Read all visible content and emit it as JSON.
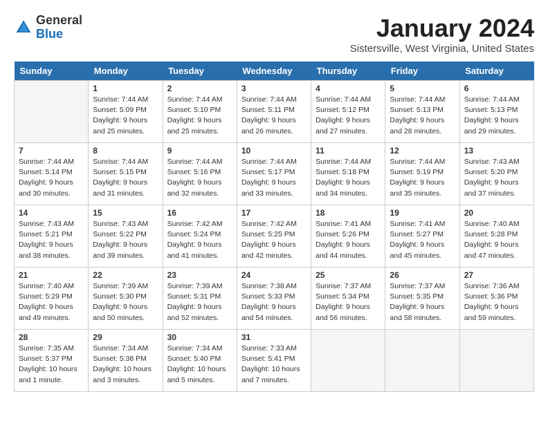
{
  "header": {
    "logo_general": "General",
    "logo_blue": "Blue",
    "month_title": "January 2024",
    "location": "Sistersville, West Virginia, United States"
  },
  "weekdays": [
    "Sunday",
    "Monday",
    "Tuesday",
    "Wednesday",
    "Thursday",
    "Friday",
    "Saturday"
  ],
  "weeks": [
    [
      {
        "day": "",
        "info": ""
      },
      {
        "day": "1",
        "info": "Sunrise: 7:44 AM\nSunset: 5:09 PM\nDaylight: 9 hours\nand 25 minutes."
      },
      {
        "day": "2",
        "info": "Sunrise: 7:44 AM\nSunset: 5:10 PM\nDaylight: 9 hours\nand 25 minutes."
      },
      {
        "day": "3",
        "info": "Sunrise: 7:44 AM\nSunset: 5:11 PM\nDaylight: 9 hours\nand 26 minutes."
      },
      {
        "day": "4",
        "info": "Sunrise: 7:44 AM\nSunset: 5:12 PM\nDaylight: 9 hours\nand 27 minutes."
      },
      {
        "day": "5",
        "info": "Sunrise: 7:44 AM\nSunset: 5:13 PM\nDaylight: 9 hours\nand 28 minutes."
      },
      {
        "day": "6",
        "info": "Sunrise: 7:44 AM\nSunset: 5:13 PM\nDaylight: 9 hours\nand 29 minutes."
      }
    ],
    [
      {
        "day": "7",
        "info": "Sunrise: 7:44 AM\nSunset: 5:14 PM\nDaylight: 9 hours\nand 30 minutes."
      },
      {
        "day": "8",
        "info": "Sunrise: 7:44 AM\nSunset: 5:15 PM\nDaylight: 9 hours\nand 31 minutes."
      },
      {
        "day": "9",
        "info": "Sunrise: 7:44 AM\nSunset: 5:16 PM\nDaylight: 9 hours\nand 32 minutes."
      },
      {
        "day": "10",
        "info": "Sunrise: 7:44 AM\nSunset: 5:17 PM\nDaylight: 9 hours\nand 33 minutes."
      },
      {
        "day": "11",
        "info": "Sunrise: 7:44 AM\nSunset: 5:18 PM\nDaylight: 9 hours\nand 34 minutes."
      },
      {
        "day": "12",
        "info": "Sunrise: 7:44 AM\nSunset: 5:19 PM\nDaylight: 9 hours\nand 35 minutes."
      },
      {
        "day": "13",
        "info": "Sunrise: 7:43 AM\nSunset: 5:20 PM\nDaylight: 9 hours\nand 37 minutes."
      }
    ],
    [
      {
        "day": "14",
        "info": "Sunrise: 7:43 AM\nSunset: 5:21 PM\nDaylight: 9 hours\nand 38 minutes."
      },
      {
        "day": "15",
        "info": "Sunrise: 7:43 AM\nSunset: 5:22 PM\nDaylight: 9 hours\nand 39 minutes."
      },
      {
        "day": "16",
        "info": "Sunrise: 7:42 AM\nSunset: 5:24 PM\nDaylight: 9 hours\nand 41 minutes."
      },
      {
        "day": "17",
        "info": "Sunrise: 7:42 AM\nSunset: 5:25 PM\nDaylight: 9 hours\nand 42 minutes."
      },
      {
        "day": "18",
        "info": "Sunrise: 7:41 AM\nSunset: 5:26 PM\nDaylight: 9 hours\nand 44 minutes."
      },
      {
        "day": "19",
        "info": "Sunrise: 7:41 AM\nSunset: 5:27 PM\nDaylight: 9 hours\nand 45 minutes."
      },
      {
        "day": "20",
        "info": "Sunrise: 7:40 AM\nSunset: 5:28 PM\nDaylight: 9 hours\nand 47 minutes."
      }
    ],
    [
      {
        "day": "21",
        "info": "Sunrise: 7:40 AM\nSunset: 5:29 PM\nDaylight: 9 hours\nand 49 minutes."
      },
      {
        "day": "22",
        "info": "Sunrise: 7:39 AM\nSunset: 5:30 PM\nDaylight: 9 hours\nand 50 minutes."
      },
      {
        "day": "23",
        "info": "Sunrise: 7:39 AM\nSunset: 5:31 PM\nDaylight: 9 hours\nand 52 minutes."
      },
      {
        "day": "24",
        "info": "Sunrise: 7:38 AM\nSunset: 5:33 PM\nDaylight: 9 hours\nand 54 minutes."
      },
      {
        "day": "25",
        "info": "Sunrise: 7:37 AM\nSunset: 5:34 PM\nDaylight: 9 hours\nand 56 minutes."
      },
      {
        "day": "26",
        "info": "Sunrise: 7:37 AM\nSunset: 5:35 PM\nDaylight: 9 hours\nand 58 minutes."
      },
      {
        "day": "27",
        "info": "Sunrise: 7:36 AM\nSunset: 5:36 PM\nDaylight: 9 hours\nand 59 minutes."
      }
    ],
    [
      {
        "day": "28",
        "info": "Sunrise: 7:35 AM\nSunset: 5:37 PM\nDaylight: 10 hours\nand 1 minute."
      },
      {
        "day": "29",
        "info": "Sunrise: 7:34 AM\nSunset: 5:38 PM\nDaylight: 10 hours\nand 3 minutes."
      },
      {
        "day": "30",
        "info": "Sunrise: 7:34 AM\nSunset: 5:40 PM\nDaylight: 10 hours\nand 5 minutes."
      },
      {
        "day": "31",
        "info": "Sunrise: 7:33 AM\nSunset: 5:41 PM\nDaylight: 10 hours\nand 7 minutes."
      },
      {
        "day": "",
        "info": ""
      },
      {
        "day": "",
        "info": ""
      },
      {
        "day": "",
        "info": ""
      }
    ]
  ]
}
